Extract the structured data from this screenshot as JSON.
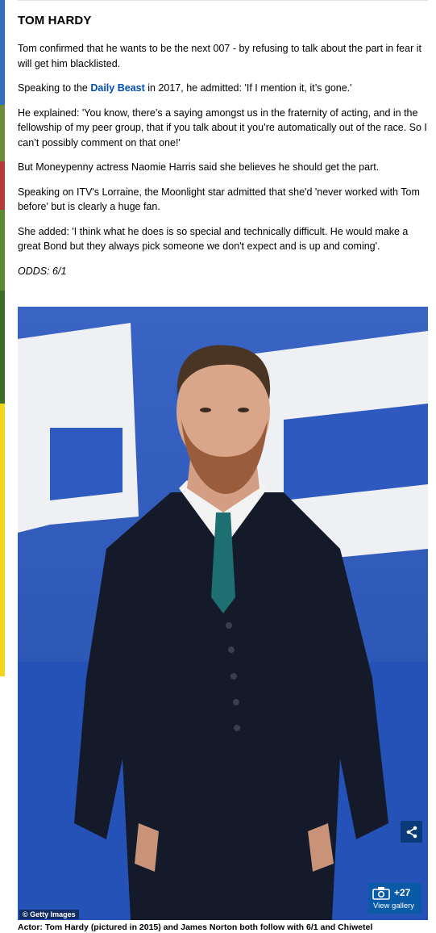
{
  "article": {
    "section_title": "TOM HARDY",
    "paragraphs": [
      "Tom confirmed that he wants to be the next 007 - by refusing to talk about the part in fear it will get him blacklisted.",
      {
        "before": "Speaking to the ",
        "link": "Daily Beast",
        "after": " in 2017, he admitted: 'If I mention it, it’s gone.'"
      },
      "He explained: 'You know, there’s a saying amongst us in the fraternity of acting, and in the fellowship of my peer group, that if you talk about it you’re automatically out of the race. So I can’t possibly comment on that one!'",
      "But Moneypenny actress Naomie Harris said she believes he should get the part.",
      "Speaking on ITV's Lorraine, the Moonlight star admitted that she'd 'never worked with Tom before' but is clearly a huge fan.",
      "She added: 'I think what he does is so special and technically difficult. He would make a great Bond but they always pick someone we don't expect and is up and coming'."
    ],
    "odds": "ODDS: 6/1"
  },
  "image": {
    "credit": "© Getty Images",
    "gallery_count": "+27",
    "gallery_label": "View gallery",
    "share_icon": "share-icon",
    "camera_icon": "camera-icon"
  },
  "caption": "Actor: Tom Hardy (pictured in 2015) and James Norton both follow with 6/1 and Chiwetel",
  "colors": {
    "link": "#004db3",
    "gallery_button": "#0a5aa8",
    "share_button": "#0b3a7a",
    "photo_backdrop": "#2c5bb8"
  }
}
